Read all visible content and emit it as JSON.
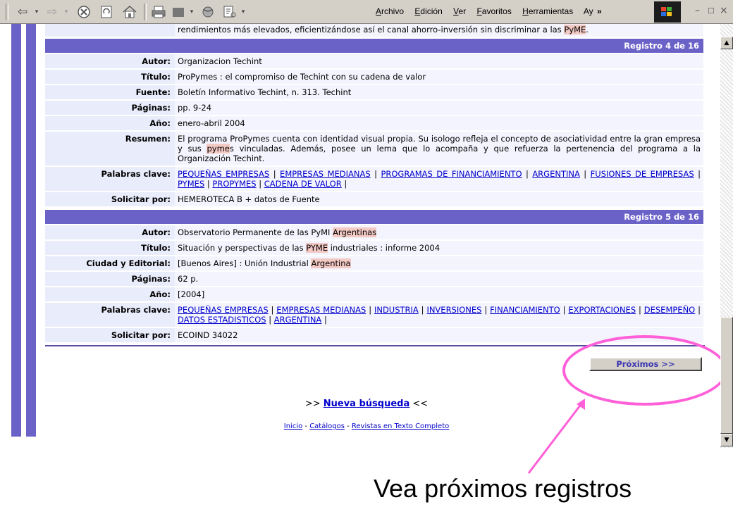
{
  "browser": {
    "menu": [
      "Archivo",
      "Edición",
      "Ver",
      "Favoritos",
      "Herramientas",
      "Ay"
    ],
    "menu_accel": [
      "A",
      "E",
      "V",
      "F",
      "H",
      ""
    ],
    "chevron": "»",
    "window_controls": [
      "–",
      "☐",
      "×"
    ]
  },
  "top_fragment": {
    "text_before": "rendimientos más elevados, eficientizándose así el canal ahorro-inversión sin discriminar a las ",
    "hl": "PyME",
    "text_after": "."
  },
  "records": [
    {
      "header": "Registro 4 de 16",
      "fields": [
        {
          "label": "Autor:",
          "value": "Organizacion Techint"
        },
        {
          "label": "Título:",
          "value": "ProPymes : el compromiso de Techint con su cadena de valor"
        },
        {
          "label": "Fuente:",
          "value": "Boletín Informativo Techint, n. 313. Techint"
        },
        {
          "label": "Páginas:",
          "value": "pp. 9-24"
        },
        {
          "label": "Año:",
          "value": "enero-abril 2004"
        },
        {
          "label": "Resumen:",
          "value_parts": [
            "El programa ProPymes cuenta con identidad visual propia. Su isologo refleja el concepto de asociatividad entre la gran empresa y sus ",
            "pyme",
            "s vinculadas. Además, posee un lema que lo acompaña y que refuerza la pertenencia del programa a la Organización Techint."
          ]
        },
        {
          "label": "Palabras clave:",
          "keywords": [
            "PEQUEÑAS EMPRESAS",
            "EMPRESAS MEDIANAS",
            "PROGRAMAS DE FINANCIAMIENTO",
            "ARGENTINA",
            "FUSIONES DE EMPRESAS",
            "PYMES",
            "PROPYMES",
            "CADENA DE VALOR"
          ]
        },
        {
          "label": "Solicitar por:",
          "value": "HEMEROTECA B + datos de Fuente"
        }
      ]
    },
    {
      "header": "Registro 5 de 16",
      "fields": [
        {
          "label": "Autor:",
          "value_parts": [
            "Observatorio Permanente de las PyMI ",
            "Argentinas",
            ""
          ]
        },
        {
          "label": "Título:",
          "value_parts": [
            "Situación y perspectivas de las ",
            "PYME",
            " industriales : informe 2004"
          ]
        },
        {
          "label": "Ciudad y Editorial:",
          "value_parts": [
            "[Buenos Aires] : Unión Industrial ",
            "Argentina",
            ""
          ]
        },
        {
          "label": "Páginas:",
          "value": "62 p."
        },
        {
          "label": "Año:",
          "value": "[2004]"
        },
        {
          "label": "Palabras clave:",
          "keywords": [
            "PEQUEÑAS EMPRESAS",
            "EMPRESAS MEDIANAS",
            "INDUSTRIA",
            "INVERSIONES",
            "FINANCIAMIENTO",
            "EXPORTACIONES",
            "DESEMPEÑO",
            "DATOS ESTADISTICOS",
            "ARGENTINA"
          ]
        },
        {
          "label": "Solicitar por:",
          "value": "ECOIND 34022"
        }
      ]
    }
  ],
  "next_button": "Próximos >>",
  "new_search": {
    "prefix": ">> ",
    "link": "Nueva búsqueda",
    "suffix": " <<"
  },
  "footer_links": [
    "Inicio",
    "Catálogos",
    "Revistas en Texto Completo"
  ],
  "caption": "Vea próximos registros",
  "colors": {
    "header": "#6b62c8",
    "highlight": "#f3c9c4",
    "annotation": "#ff5fd8",
    "link": "#0000cc"
  }
}
